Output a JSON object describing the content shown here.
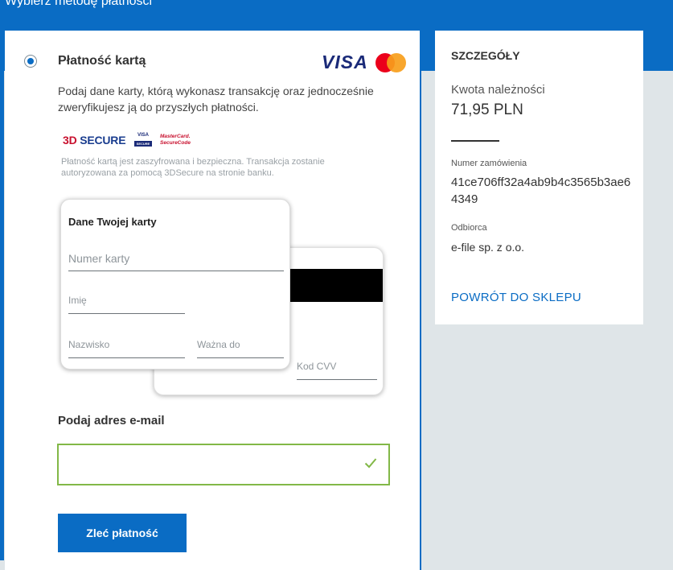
{
  "page": {
    "heading": "Wybierz metodę płatności"
  },
  "payment": {
    "method_title": "Płatność kartą",
    "brand_visa": "VISA",
    "description": "Podaj dane karty, którą wykonasz transakcję oraz jednocześnie zweryfikujesz ją do przyszłych płatności.",
    "badge_3ds": {
      "prefix": "3D",
      "rest": " SECURE"
    },
    "badge_vbv": {
      "top": "VISA",
      "bottom": "SECURE"
    },
    "badge_mcsc": {
      "line1": "MasterCard.",
      "line2": "SecureCode"
    },
    "security_note": "Płatność kartą jest zaszyfrowana i bezpieczna. Transakcja zostanie autoryzowana za pomocą 3DSecure na stronie banku."
  },
  "card": {
    "title": "Dane Twojej karty",
    "number_placeholder": "Numer karty",
    "first_name_label": "Imię",
    "last_name_label": "Nazwisko",
    "expiry_label": "Ważna do",
    "cvv_label": "Kod CVV"
  },
  "email": {
    "title": "Podaj adres e-mail",
    "value": ""
  },
  "submit": {
    "label": "Zleć płatność"
  },
  "details": {
    "title": "SZCZEGÓŁY",
    "due_label": "Kwota należności",
    "due_value": "71,95 PLN",
    "order_label": "Numer zamówienia",
    "order_value": "41ce706ff32a4ab9b4c3565b3ae64349",
    "recipient_label": "Odbiorca",
    "recipient_value": "e-file sp. z o.o.",
    "back_link": "POWRÓT DO SKLEPU"
  },
  "colors": {
    "primary": "#0a6cc4",
    "valid": "#82b847",
    "background": "#dfe5e8"
  }
}
